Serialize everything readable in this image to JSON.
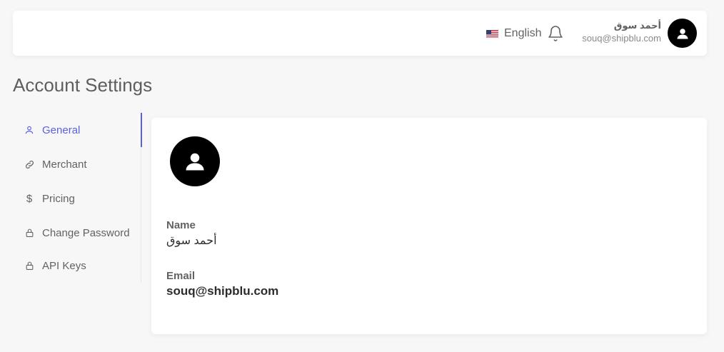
{
  "header": {
    "language": "English",
    "user_name": "أحمد سوق",
    "user_email": "souq@shipblu.com"
  },
  "page": {
    "title": "Account Settings"
  },
  "sidebar": {
    "items": [
      {
        "label": "General",
        "icon": "user-icon",
        "active": true
      },
      {
        "label": "Merchant",
        "icon": "link-icon",
        "active": false
      },
      {
        "label": "Pricing",
        "icon": "dollar-icon",
        "active": false
      },
      {
        "label": "Change Password",
        "icon": "lock-icon",
        "active": false
      },
      {
        "label": "API Keys",
        "icon": "lock-icon",
        "active": false
      }
    ]
  },
  "profile": {
    "name_label": "Name",
    "name_value": "أحمد سوق",
    "email_label": "Email",
    "email_value": "souq@shipblu.com"
  },
  "colors": {
    "accent": "#5b5fe2",
    "background": "#f7f7f7",
    "card": "#ffffff"
  }
}
